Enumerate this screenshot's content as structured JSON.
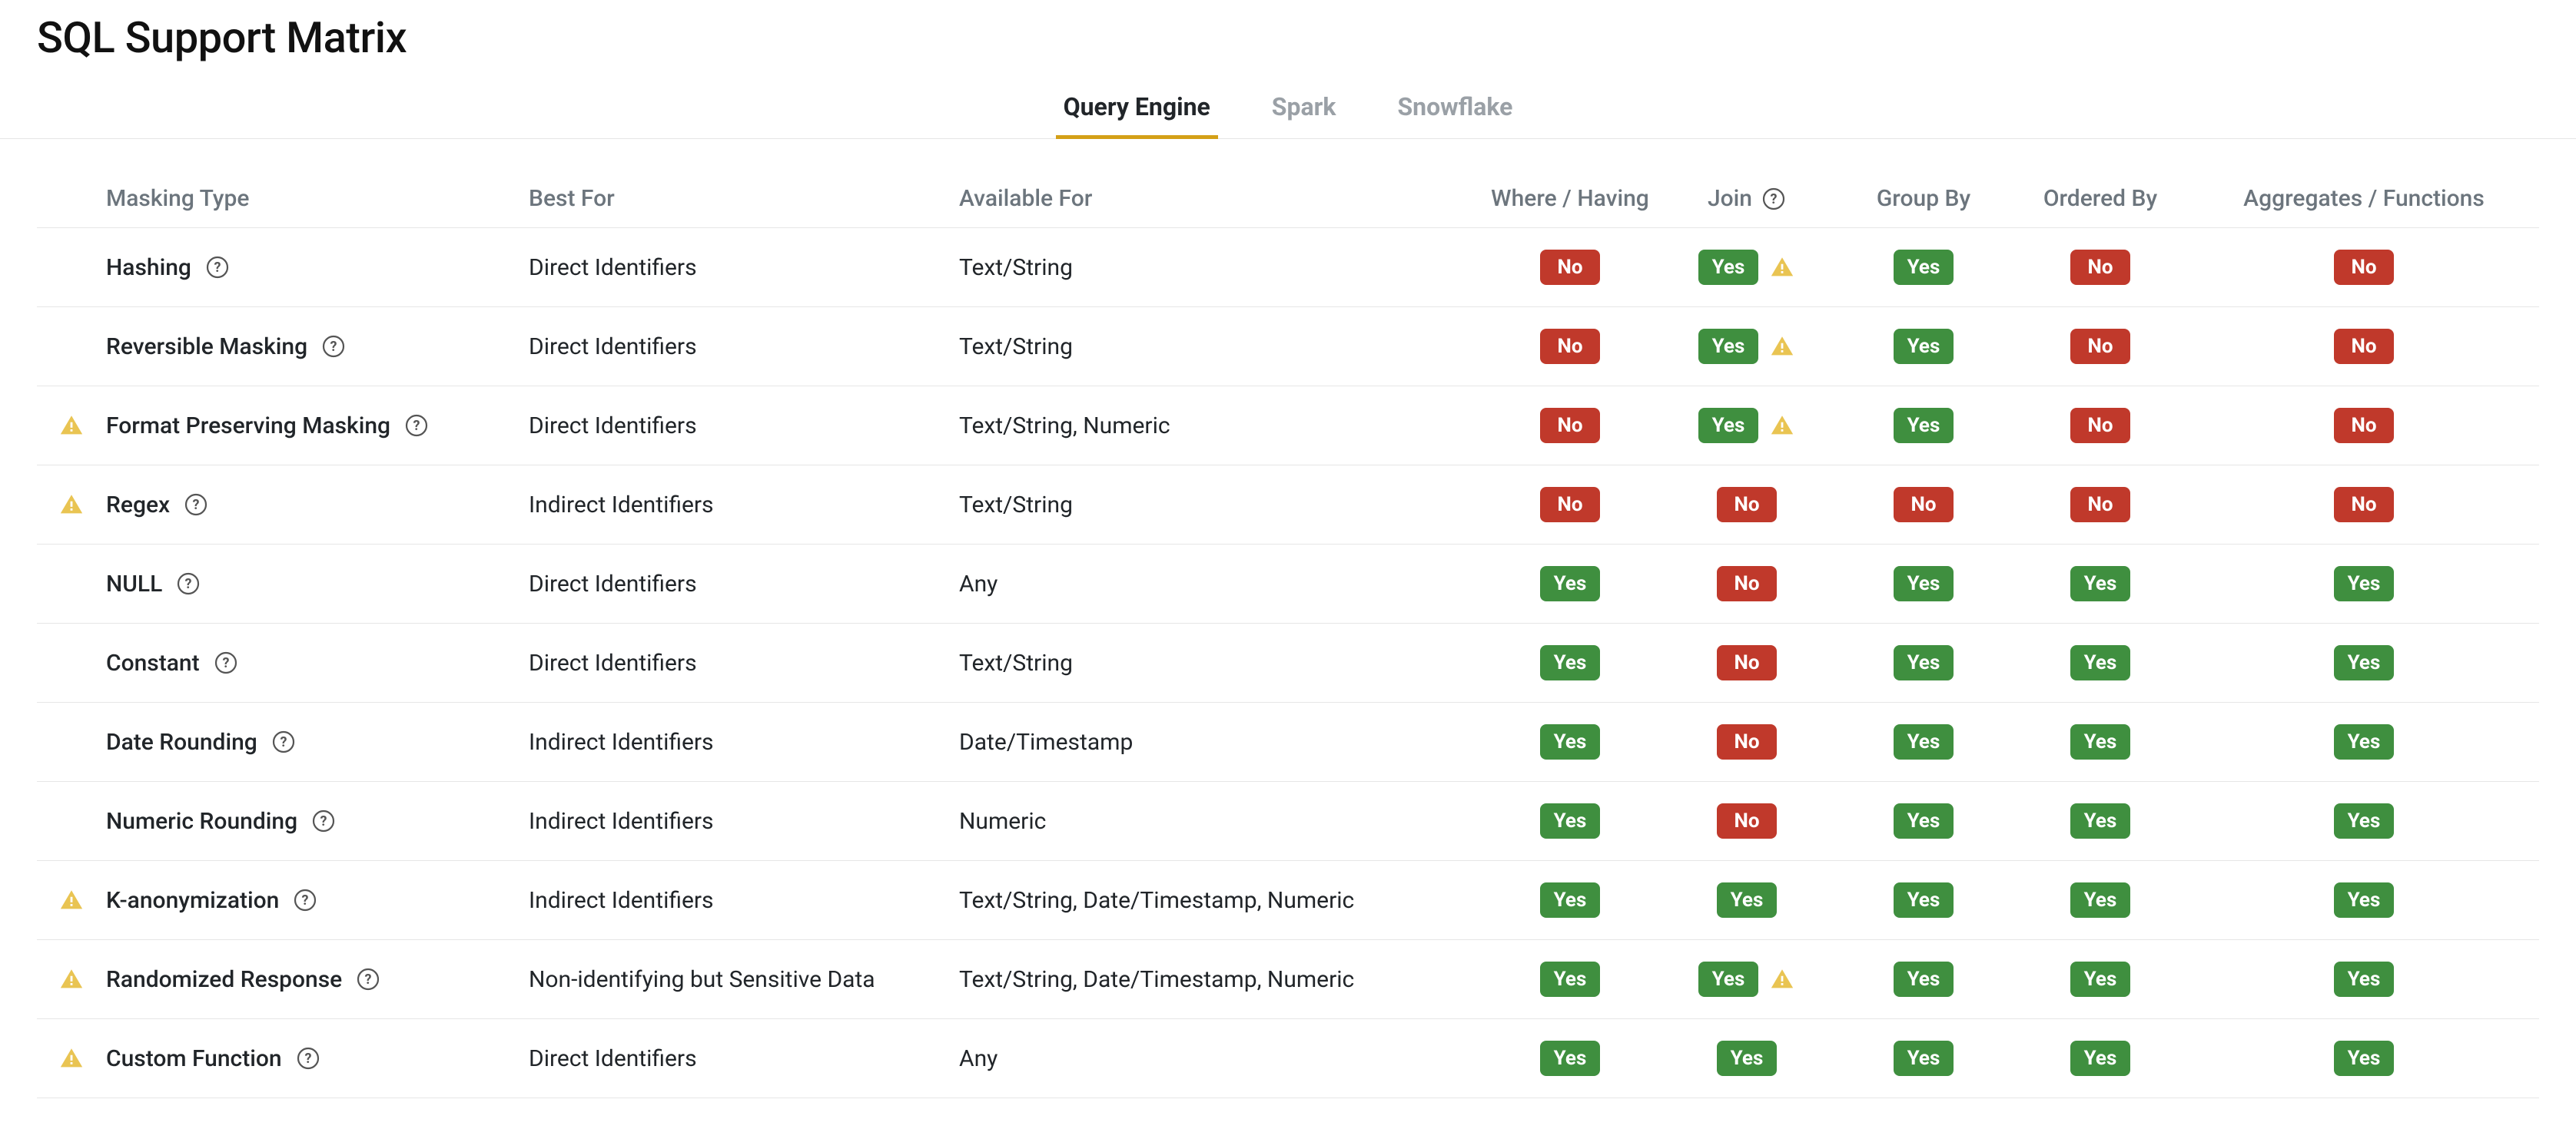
{
  "title": "SQL Support Matrix",
  "tabs": [
    {
      "label": "Query Engine",
      "active": true
    },
    {
      "label": "Spark",
      "active": false
    },
    {
      "label": "Snowflake",
      "active": false
    }
  ],
  "columns": {
    "masking_type": "Masking Type",
    "best_for": "Best For",
    "available_for": "Available For",
    "where_having": "Where / Having",
    "join": "Join",
    "group_by": "Group By",
    "ordered_by": "Ordered By",
    "aggregates": "Aggregates / Functions"
  },
  "badge_labels": {
    "yes": "Yes",
    "no": "No"
  },
  "rows": [
    {
      "warn": false,
      "type": "Hashing",
      "help": true,
      "best": "Direct Identifiers",
      "avail": "Text/String",
      "where": "no",
      "join": "yes",
      "join_warn": true,
      "group": "yes",
      "order": "no",
      "agg": "no"
    },
    {
      "warn": false,
      "type": "Reversible Masking",
      "help": true,
      "best": "Direct Identifiers",
      "avail": "Text/String",
      "where": "no",
      "join": "yes",
      "join_warn": true,
      "group": "yes",
      "order": "no",
      "agg": "no"
    },
    {
      "warn": true,
      "type": "Format Preserving Masking",
      "help": true,
      "best": "Direct Identifiers",
      "avail": "Text/String, Numeric",
      "where": "no",
      "join": "yes",
      "join_warn": true,
      "group": "yes",
      "order": "no",
      "agg": "no"
    },
    {
      "warn": true,
      "type": "Regex",
      "help": true,
      "best": "Indirect Identifiers",
      "avail": "Text/String",
      "where": "no",
      "join": "no",
      "join_warn": false,
      "group": "no",
      "order": "no",
      "agg": "no"
    },
    {
      "warn": false,
      "type": "NULL",
      "help": true,
      "best": "Direct Identifiers",
      "avail": "Any",
      "where": "yes",
      "join": "no",
      "join_warn": false,
      "group": "yes",
      "order": "yes",
      "agg": "yes"
    },
    {
      "warn": false,
      "type": "Constant",
      "help": true,
      "best": "Direct Identifiers",
      "avail": "Text/String",
      "where": "yes",
      "join": "no",
      "join_warn": false,
      "group": "yes",
      "order": "yes",
      "agg": "yes"
    },
    {
      "warn": false,
      "type": "Date Rounding",
      "help": true,
      "best": "Indirect Identifiers",
      "avail": "Date/Timestamp",
      "where": "yes",
      "join": "no",
      "join_warn": false,
      "group": "yes",
      "order": "yes",
      "agg": "yes"
    },
    {
      "warn": false,
      "type": "Numeric Rounding",
      "help": true,
      "best": "Indirect Identifiers",
      "avail": "Numeric",
      "where": "yes",
      "join": "no",
      "join_warn": false,
      "group": "yes",
      "order": "yes",
      "agg": "yes"
    },
    {
      "warn": true,
      "type": "K-anonymization",
      "help": true,
      "best": "Indirect Identifiers",
      "avail": "Text/String, Date/Timestamp, Numeric",
      "where": "yes",
      "join": "yes",
      "join_warn": false,
      "group": "yes",
      "order": "yes",
      "agg": "yes"
    },
    {
      "warn": true,
      "type": "Randomized Response",
      "help": true,
      "best": "Non-identifying but Sensitive Data",
      "avail": "Text/String, Date/Timestamp, Numeric",
      "where": "yes",
      "join": "yes",
      "join_warn": true,
      "group": "yes",
      "order": "yes",
      "agg": "yes"
    },
    {
      "warn": true,
      "type": "Custom Function",
      "help": true,
      "best": "Direct Identifiers",
      "avail": "Any",
      "where": "yes",
      "join": "yes",
      "join_warn": false,
      "group": "yes",
      "order": "yes",
      "agg": "yes"
    }
  ]
}
